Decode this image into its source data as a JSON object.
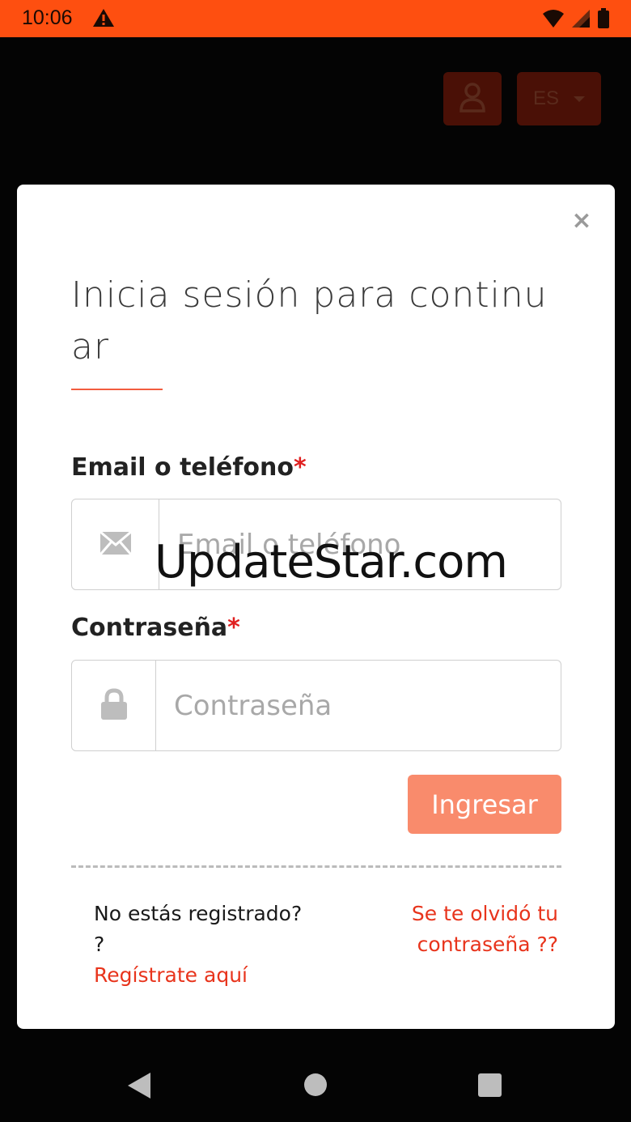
{
  "status_bar": {
    "time": "10:06",
    "warning_icon": "warning-icon",
    "wifi_icon": "wifi-icon",
    "signal_icon": "signal-icon",
    "battery_icon": "battery-icon",
    "color": "#fe4f10"
  },
  "header": {
    "user_icon": "user-icon",
    "language": "ES"
  },
  "modal": {
    "close_label": "×",
    "title": "Inicia sesión para continuar",
    "email": {
      "label": "Email o teléfono",
      "required_mark": "*",
      "placeholder": "Email o teléfono",
      "icon": "envelope-icon"
    },
    "password": {
      "label": "Contraseña",
      "required_mark": "*",
      "placeholder": "Contraseña",
      "icon": "lock-icon"
    },
    "submit_label": "Ingresar",
    "register_prompt": "No estás registrado? ?",
    "register_link": "Regístrate aquí",
    "forgot_link": "Se te olvidó tu contraseña ??"
  },
  "watermark": "UpdateStar.com",
  "colors": {
    "accent": "#f25c3f",
    "button": "#f98b6c",
    "link": "#e8341c"
  }
}
